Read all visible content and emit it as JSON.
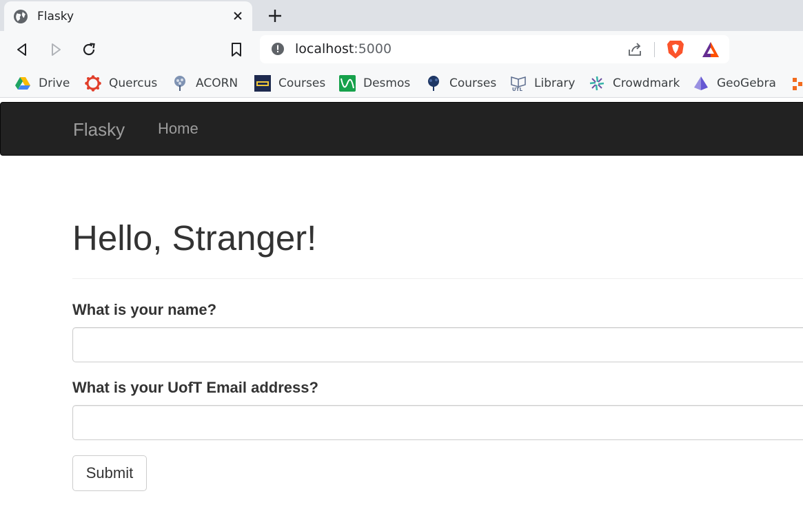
{
  "browser": {
    "tab": {
      "title": "Flasky",
      "icon": "globe-icon"
    },
    "address_bar": {
      "host": "localhost",
      "port": ":5000"
    },
    "bookmarks": [
      {
        "label": "Drive",
        "icon": "google-drive-icon"
      },
      {
        "label": "Quercus",
        "icon": "quercus-icon"
      },
      {
        "label": "ACORN",
        "icon": "acorn-icon"
      },
      {
        "label": "Courses",
        "icon": "skule-courses-icon"
      },
      {
        "label": "Desmos",
        "icon": "desmos-icon"
      },
      {
        "label": "Courses",
        "icon": "uoft-courses-icon"
      },
      {
        "label": "Library",
        "icon": "utl-library-icon"
      },
      {
        "label": "Crowdmark",
        "icon": "crowdmark-icon"
      },
      {
        "label": "GeoGebra",
        "icon": "geogebra-icon"
      }
    ]
  },
  "navbar": {
    "brand": "Flasky",
    "links": [
      "Home"
    ],
    "background": "#222222",
    "link_color": "#9d9d9d"
  },
  "page": {
    "heading": "Hello, Stranger!",
    "form": {
      "name_label": "What is your name?",
      "name_value": "",
      "email_label": "What is your UofT Email address?",
      "email_value": "",
      "submit_label": "Submit"
    }
  }
}
